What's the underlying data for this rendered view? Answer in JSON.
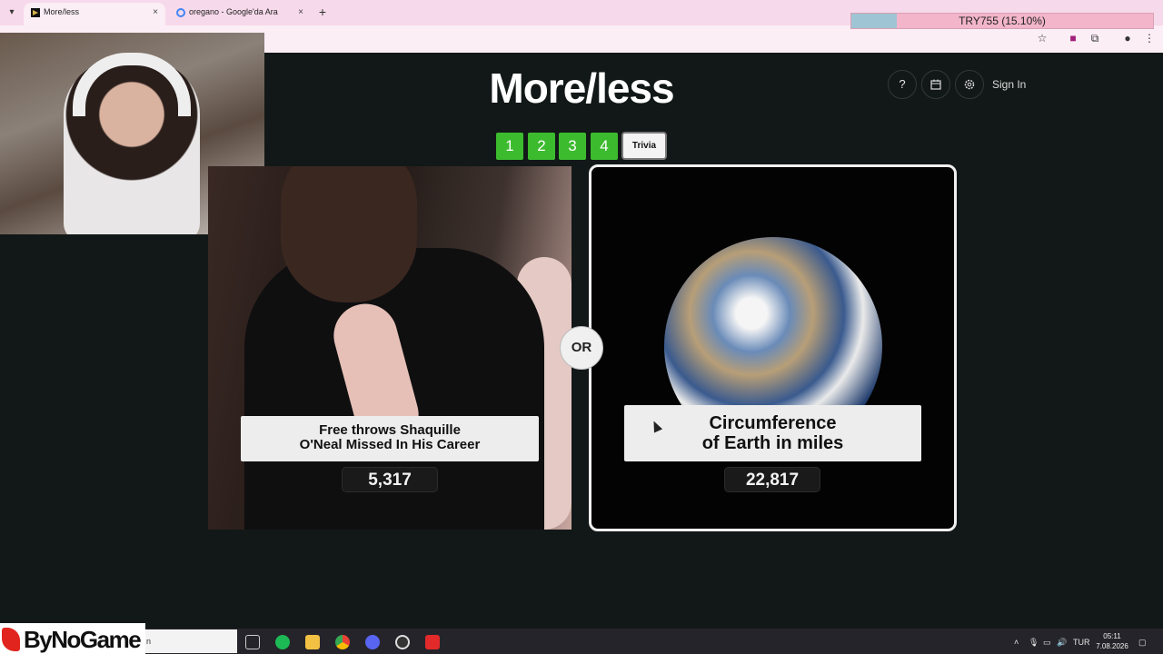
{
  "browser": {
    "tabs": [
      {
        "title": "More/less"
      },
      {
        "title": "oregano - Google'da Ara"
      }
    ],
    "new_tab": "+",
    "close": "×"
  },
  "overlay": {
    "donation_text": "TRY755 (15.10%)",
    "donation_progress": 0.151,
    "brand": "ByNoGame",
    "search_text": "n"
  },
  "header": {
    "logo": "More/less",
    "help": "?",
    "sign_in": "Sign In"
  },
  "levels": {
    "items": [
      "1",
      "2",
      "3",
      "4"
    ],
    "trivia": "Trivia"
  },
  "cards": {
    "left": {
      "title_line1": "Free throws Shaquille",
      "title_line2": "O'Neal Missed In His Career",
      "value": "5,317"
    },
    "or": "OR",
    "right": {
      "title_line1": "Circumference",
      "title_line2": "of Earth in miles",
      "value": "22,817"
    }
  },
  "taskbar": {
    "lang": "TUR",
    "time": "05:11",
    "date": "7.08.2026"
  },
  "colors": {
    "level_green": "#3dbb2f",
    "page_bg": "#121817",
    "tab_strip": "#f6d9ea"
  }
}
